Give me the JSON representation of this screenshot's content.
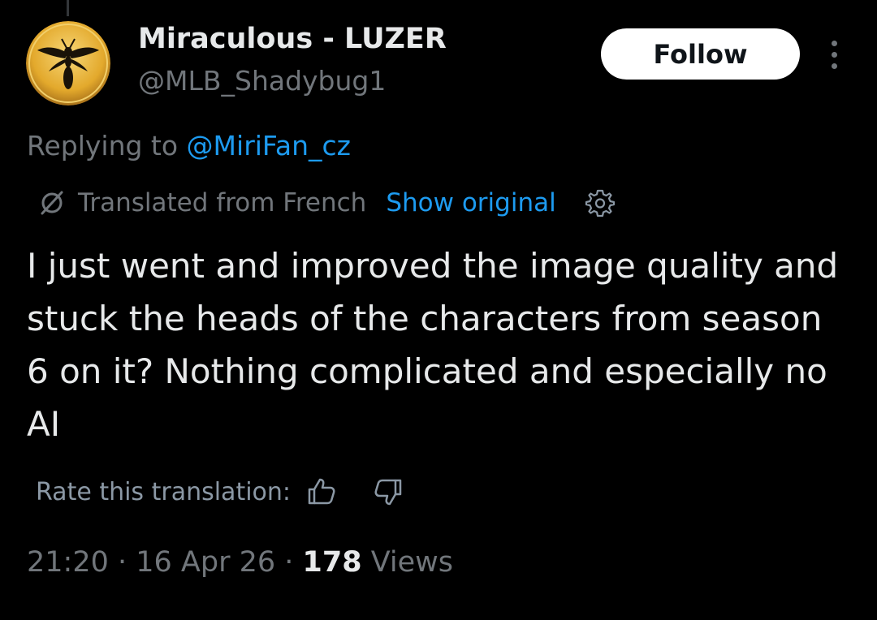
{
  "author": {
    "display_name": "Miraculous - LUZER",
    "handle": "@MLB_Shadybug1",
    "avatar_icon": "wasp-emblem-icon"
  },
  "actions": {
    "follow_label": "Follow",
    "more_icon": "more-vertical-icon"
  },
  "reply": {
    "prefix": "Replying to ",
    "mention": "@MiriFan_cz"
  },
  "translation": {
    "icon": "translate-icon",
    "label": "Translated from French",
    "show_original": "Show original",
    "settings_icon": "gear-icon",
    "rate_label": "Rate this translation:",
    "thumbs_up_icon": "thumbs-up-icon",
    "thumbs_down_icon": "thumbs-down-icon"
  },
  "tweet": {
    "text": "I just went and improved the image quality and stuck the heads of the characters from season 6 on it? Nothing complicated and especially no AI"
  },
  "meta": {
    "time": "21:20",
    "separator": " · ",
    "date": "16 Apr 26",
    "views_count": "178",
    "views_label": " Views"
  },
  "colors": {
    "background": "#000000",
    "primary_text": "#e7e9ea",
    "secondary_text": "#71767b",
    "link": "#1d9bf0",
    "avatar_gold": "#e8b43a"
  }
}
